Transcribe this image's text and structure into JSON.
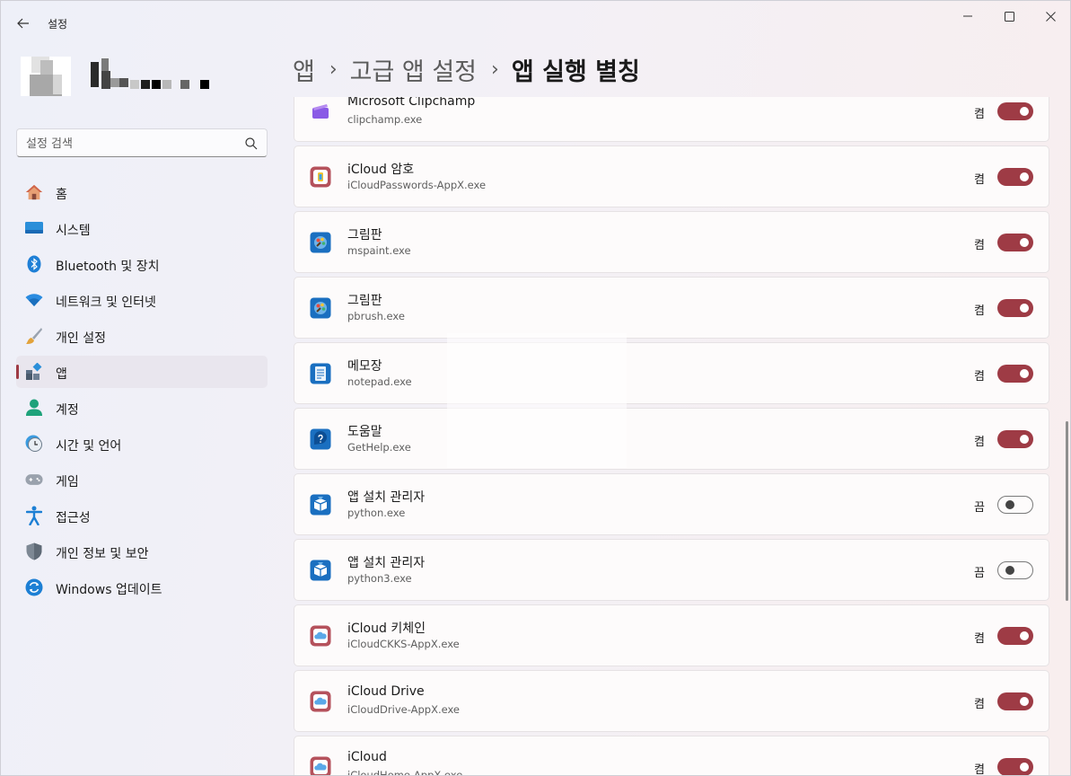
{
  "window": {
    "title": "설정"
  },
  "search": {
    "placeholder": "설정 검색"
  },
  "nav": [
    {
      "label": "홈",
      "icon": "home-icon",
      "selected": false
    },
    {
      "label": "시스템",
      "icon": "system-icon",
      "selected": false
    },
    {
      "label": "Bluetooth 및 장치",
      "icon": "bluetooth-icon",
      "selected": false
    },
    {
      "label": "네트워크 및 인터넷",
      "icon": "wifi-icon",
      "selected": false
    },
    {
      "label": "개인 설정",
      "icon": "brush-icon",
      "selected": false
    },
    {
      "label": "앱",
      "icon": "apps-icon",
      "selected": true
    },
    {
      "label": "계정",
      "icon": "account-icon",
      "selected": false
    },
    {
      "label": "시간 및 언어",
      "icon": "clock-globe-icon",
      "selected": false
    },
    {
      "label": "게임",
      "icon": "gamepad-icon",
      "selected": false
    },
    {
      "label": "접근성",
      "icon": "accessibility-icon",
      "selected": false
    },
    {
      "label": "개인 정보 및 보안",
      "icon": "shield-icon",
      "selected": false
    },
    {
      "label": "Windows 업데이트",
      "icon": "update-icon",
      "selected": false
    }
  ],
  "breadcrumb": {
    "part1": "앱",
    "part2": "고급 앱 설정",
    "current": "앱 실행 별칭"
  },
  "colors": {
    "accent": "#9e3b45"
  },
  "aliases": [
    {
      "name": "Microsoft Clipchamp",
      "exe": "clipchamp.exe",
      "state": "켬",
      "on": true,
      "icon": "clipchamp-icon"
    },
    {
      "name": "iCloud 암호",
      "exe": "iCloudPasswords-AppX.exe",
      "state": "켬",
      "on": true,
      "icon": "icloud-passwords-icon"
    },
    {
      "name": "그림판",
      "exe": "mspaint.exe",
      "state": "켬",
      "on": true,
      "icon": "paint-icon"
    },
    {
      "name": "그림판",
      "exe": "pbrush.exe",
      "state": "켬",
      "on": true,
      "icon": "paint-icon"
    },
    {
      "name": "메모장",
      "exe": "notepad.exe",
      "state": "켬",
      "on": true,
      "icon": "notepad-icon"
    },
    {
      "name": "도움말",
      "exe": "GetHelp.exe",
      "state": "켬",
      "on": true,
      "icon": "get-help-icon"
    },
    {
      "name": "앱 설치 관리자",
      "exe": "python.exe",
      "state": "끔",
      "on": false,
      "icon": "app-installer-icon"
    },
    {
      "name": "앱 설치 관리자",
      "exe": "python3.exe",
      "state": "끔",
      "on": false,
      "icon": "app-installer-icon"
    },
    {
      "name": "iCloud 키체인",
      "exe": "iCloudCKKS-AppX.exe",
      "state": "켬",
      "on": true,
      "icon": "icloud-icon"
    },
    {
      "name": "iCloud Drive",
      "exe": "iCloudDrive-AppX.exe",
      "state": "켬",
      "on": true,
      "icon": "icloud-icon"
    },
    {
      "name": "iCloud",
      "exe": "iCloudHome-AppX.exe",
      "state": "켬",
      "on": true,
      "icon": "icloud-icon"
    }
  ]
}
